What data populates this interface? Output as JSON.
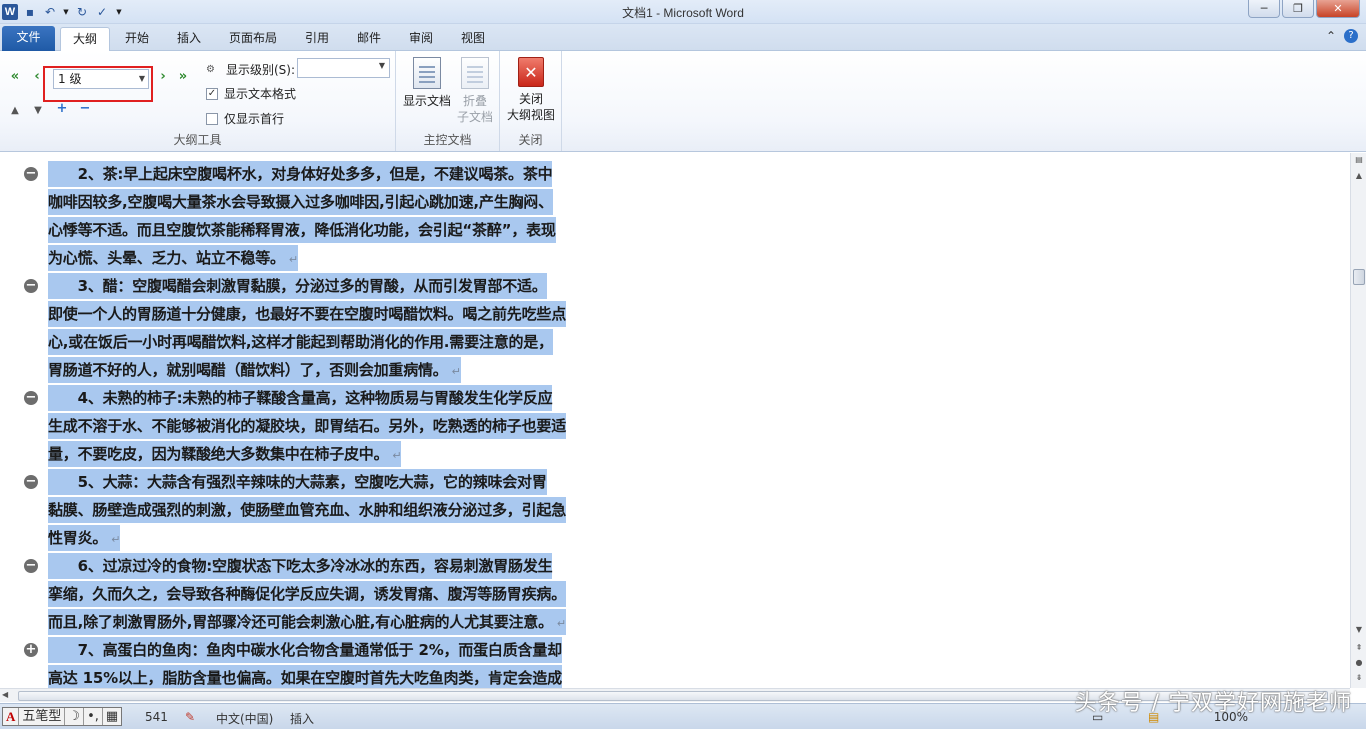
{
  "window": {
    "title": "文档1 - Microsoft Word",
    "minimize_glyph": "─",
    "restore_glyph": "❐",
    "close_glyph": "✕"
  },
  "qat": {
    "icons": [
      "word-logo",
      "save-icon",
      "undo-icon",
      "redo-icon",
      "spelling-icon",
      "customize-qat-icon"
    ],
    "word_glyph": "W"
  },
  "tabs": {
    "file": "文件",
    "items": [
      "大纲",
      "开始",
      "插入",
      "页面布局",
      "引用",
      "邮件",
      "审阅",
      "视图"
    ],
    "active": "大纲"
  },
  "ribbon": {
    "outline_tools": {
      "level_value": "1 级",
      "show_level_label": "显示级别(S):",
      "show_text_format_label": "显示文本格式",
      "show_text_format_checked": true,
      "show_first_line_label": "仅显示首行",
      "show_first_line_checked": false,
      "group_label": "大纲工具"
    },
    "master_document": {
      "show_document_label": "显示文档",
      "collapse_subdocs_label_1": "折叠",
      "collapse_subdocs_label_2": "子文档",
      "group_label": "主控文档"
    },
    "close": {
      "close_label_1": "关闭",
      "close_label_2": "大纲视图",
      "group_label": "关闭"
    }
  },
  "document": {
    "paragraphs": [
      {
        "symbol": "minus",
        "lines": [
          "　　2、茶:早上起床空腹喝杯水，对身体好处多多，但是，不建议喝茶。茶中",
          "咖啡因较多,空腹喝大量茶水会导致摄入过多咖啡因,引起心跳加速,产生胸闷、",
          "心悸等不适。而且空腹饮茶能稀释胃液，降低消化功能，会引起“茶醉”，表现",
          "为心慌、头晕、乏力、站立不稳等。"
        ]
      },
      {
        "symbol": "minus",
        "lines": [
          "　　3、醋：空腹喝醋会刺激胃黏膜，分泌过多的胃酸，从而引发胃部不适。",
          "即使一个人的胃肠道十分健康，也最好不要在空腹时喝醋饮料。喝之前先吃些点",
          "心,或在饭后一小时再喝醋饮料,这样才能起到帮助消化的作用.需要注意的是，",
          "胃肠道不好的人，就别喝醋（醋饮料）了，否则会加重病情。"
        ]
      },
      {
        "symbol": "minus",
        "lines": [
          "　　4、未熟的柿子:未熟的柿子鞣酸含量高，这种物质易与胃酸发生化学反应",
          "生成不溶于水、不能够被消化的凝胶块，即胃结石。另外，吃熟透的柿子也要适",
          "量，不要吃皮，因为鞣酸绝大多数集中在柿子皮中。"
        ]
      },
      {
        "symbol": "minus",
        "lines": [
          "　　5、大蒜：大蒜含有强烈辛辣味的大蒜素，空腹吃大蒜，它的辣味会对胃",
          "黏膜、肠壁造成强烈的刺激，使肠壁血管充血、水肿和组织液分泌过多，引起急",
          "性胃炎。"
        ]
      },
      {
        "symbol": "minus",
        "lines": [
          "　　6、过凉过冷的食物:空腹状态下吃太多冷冰冰的东西，容易刺激胃肠发生",
          "挛缩，久而久之，会导致各种酶促化学反应失调，诱发胃痛、腹泻等肠胃疾病。",
          "而且,除了刺激胃肠外,胃部骤冷还可能会刺激心脏,有心脏病的人尤其要注意。"
        ]
      },
      {
        "symbol": "plus",
        "lines": [
          "　　7、高蛋白的鱼肉：鱼肉中碳水化合物含量通常低于 2%，而蛋白质含量却",
          "高达 15%以上，脂肪含量也偏高。如果在空腹时首先大吃鱼肉类，肯定会造成"
        ]
      }
    ],
    "paragraph_mark": "↵"
  },
  "statusbar": {
    "ime_a": "A",
    "ime_name": "五笔型",
    "ime_moon": "☽",
    "ime_dots": "•,",
    "ime_kbd": "▦",
    "word_count": "541",
    "language": "中文(中国)",
    "insert_mode": "插入",
    "zoom": "100%"
  },
  "watermark": "头条号 / 宁双学好网施老师"
}
